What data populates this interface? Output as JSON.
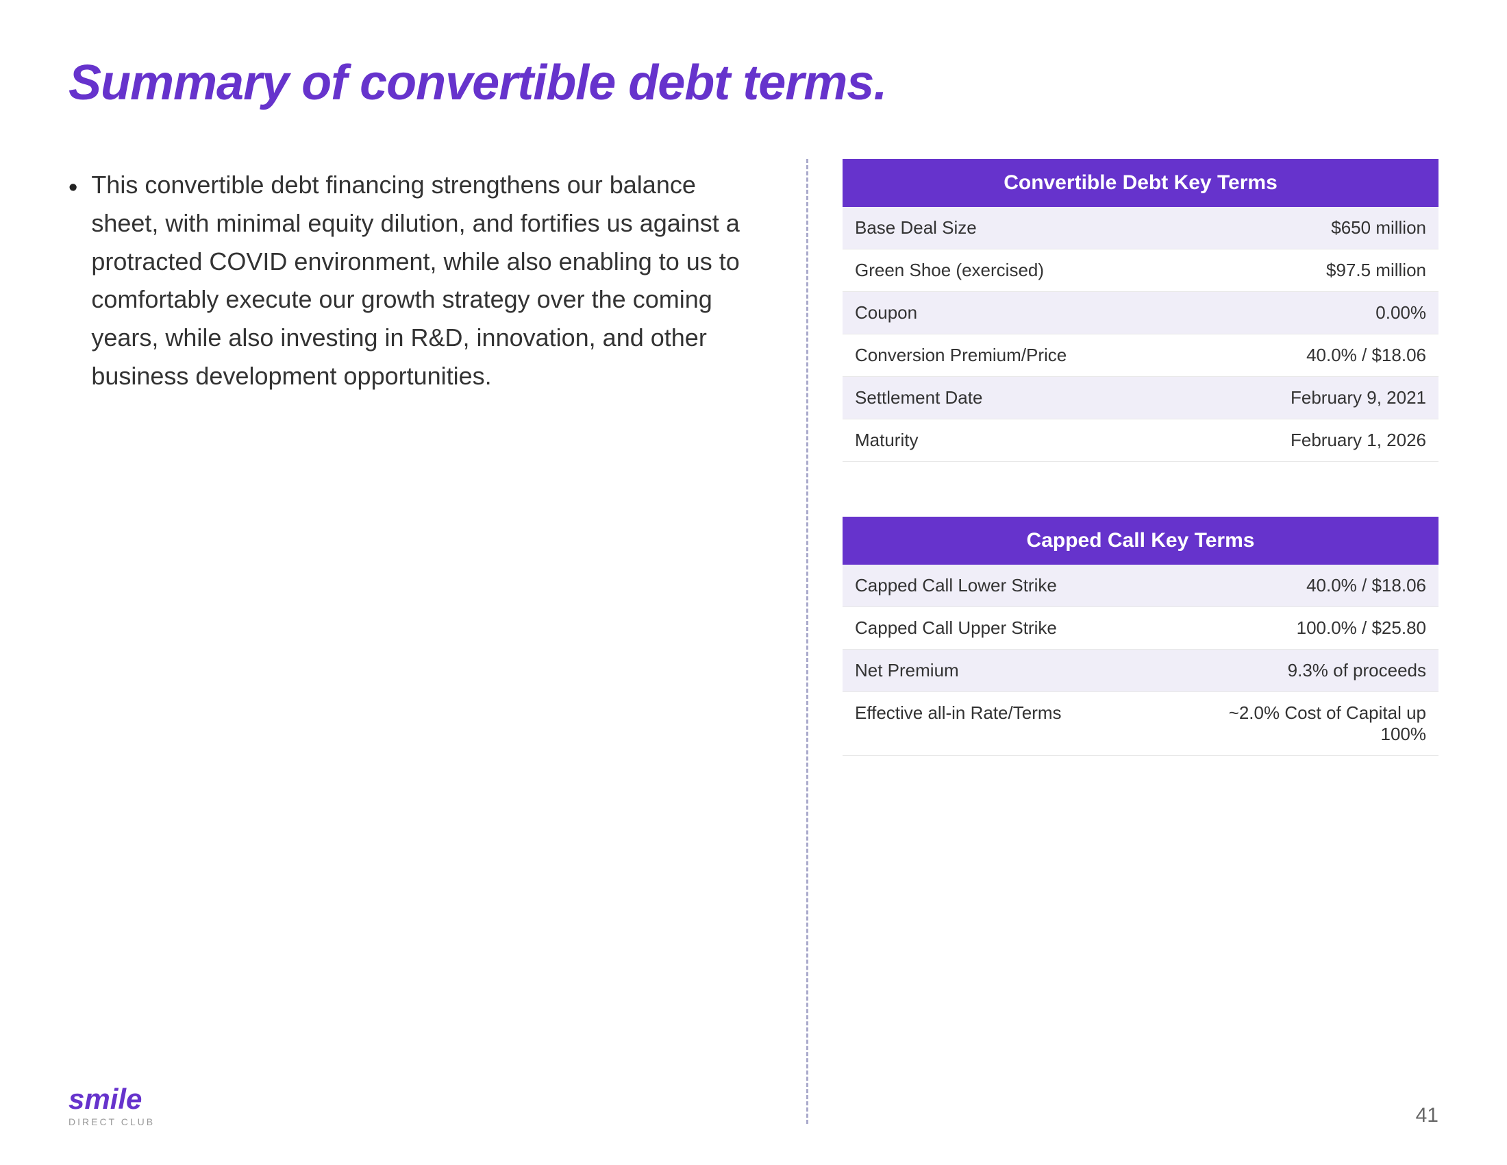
{
  "page": {
    "title": "Summary of convertible debt terms.",
    "page_number": "41"
  },
  "left": {
    "bullet_text": "This convertible debt financing strengthens our balance sheet, with minimal equity dilution, and fortifies us against a protracted COVID environment, while also enabling to us to comfortably execute our growth strategy over the coming years, while also investing in R&D, innovation, and other business development opportunities."
  },
  "convertible_table": {
    "header": "Convertible Debt Key Terms",
    "rows": [
      {
        "label": "Base Deal Size",
        "value": "$650 million"
      },
      {
        "label": "Green Shoe (exercised)",
        "value": "$97.5 million"
      },
      {
        "label": "Coupon",
        "value": "0.00%"
      },
      {
        "label": "Conversion Premium/Price",
        "value": "40.0% / $18.06"
      },
      {
        "label": "Settlement Date",
        "value": "February 9, 2021"
      },
      {
        "label": "Maturity",
        "value": "February 1, 2026"
      }
    ]
  },
  "capped_call_table": {
    "header": "Capped Call Key Terms",
    "rows": [
      {
        "label": "Capped Call Lower Strike",
        "value": "40.0% / $18.06"
      },
      {
        "label": "Capped Call Upper Strike",
        "value": "100.0% / $25.80"
      },
      {
        "label": "Net Premium",
        "value": "9.3% of proceeds"
      },
      {
        "label": "Effective all-in Rate/Terms",
        "value": "~2.0% Cost of Capital up 100%"
      }
    ]
  },
  "logo": {
    "smile": "smile",
    "subtitle": "DIRECT CLUB"
  },
  "colors": {
    "purple": "#6633cc",
    "text": "#333333",
    "row_alt": "#f0eef8"
  }
}
